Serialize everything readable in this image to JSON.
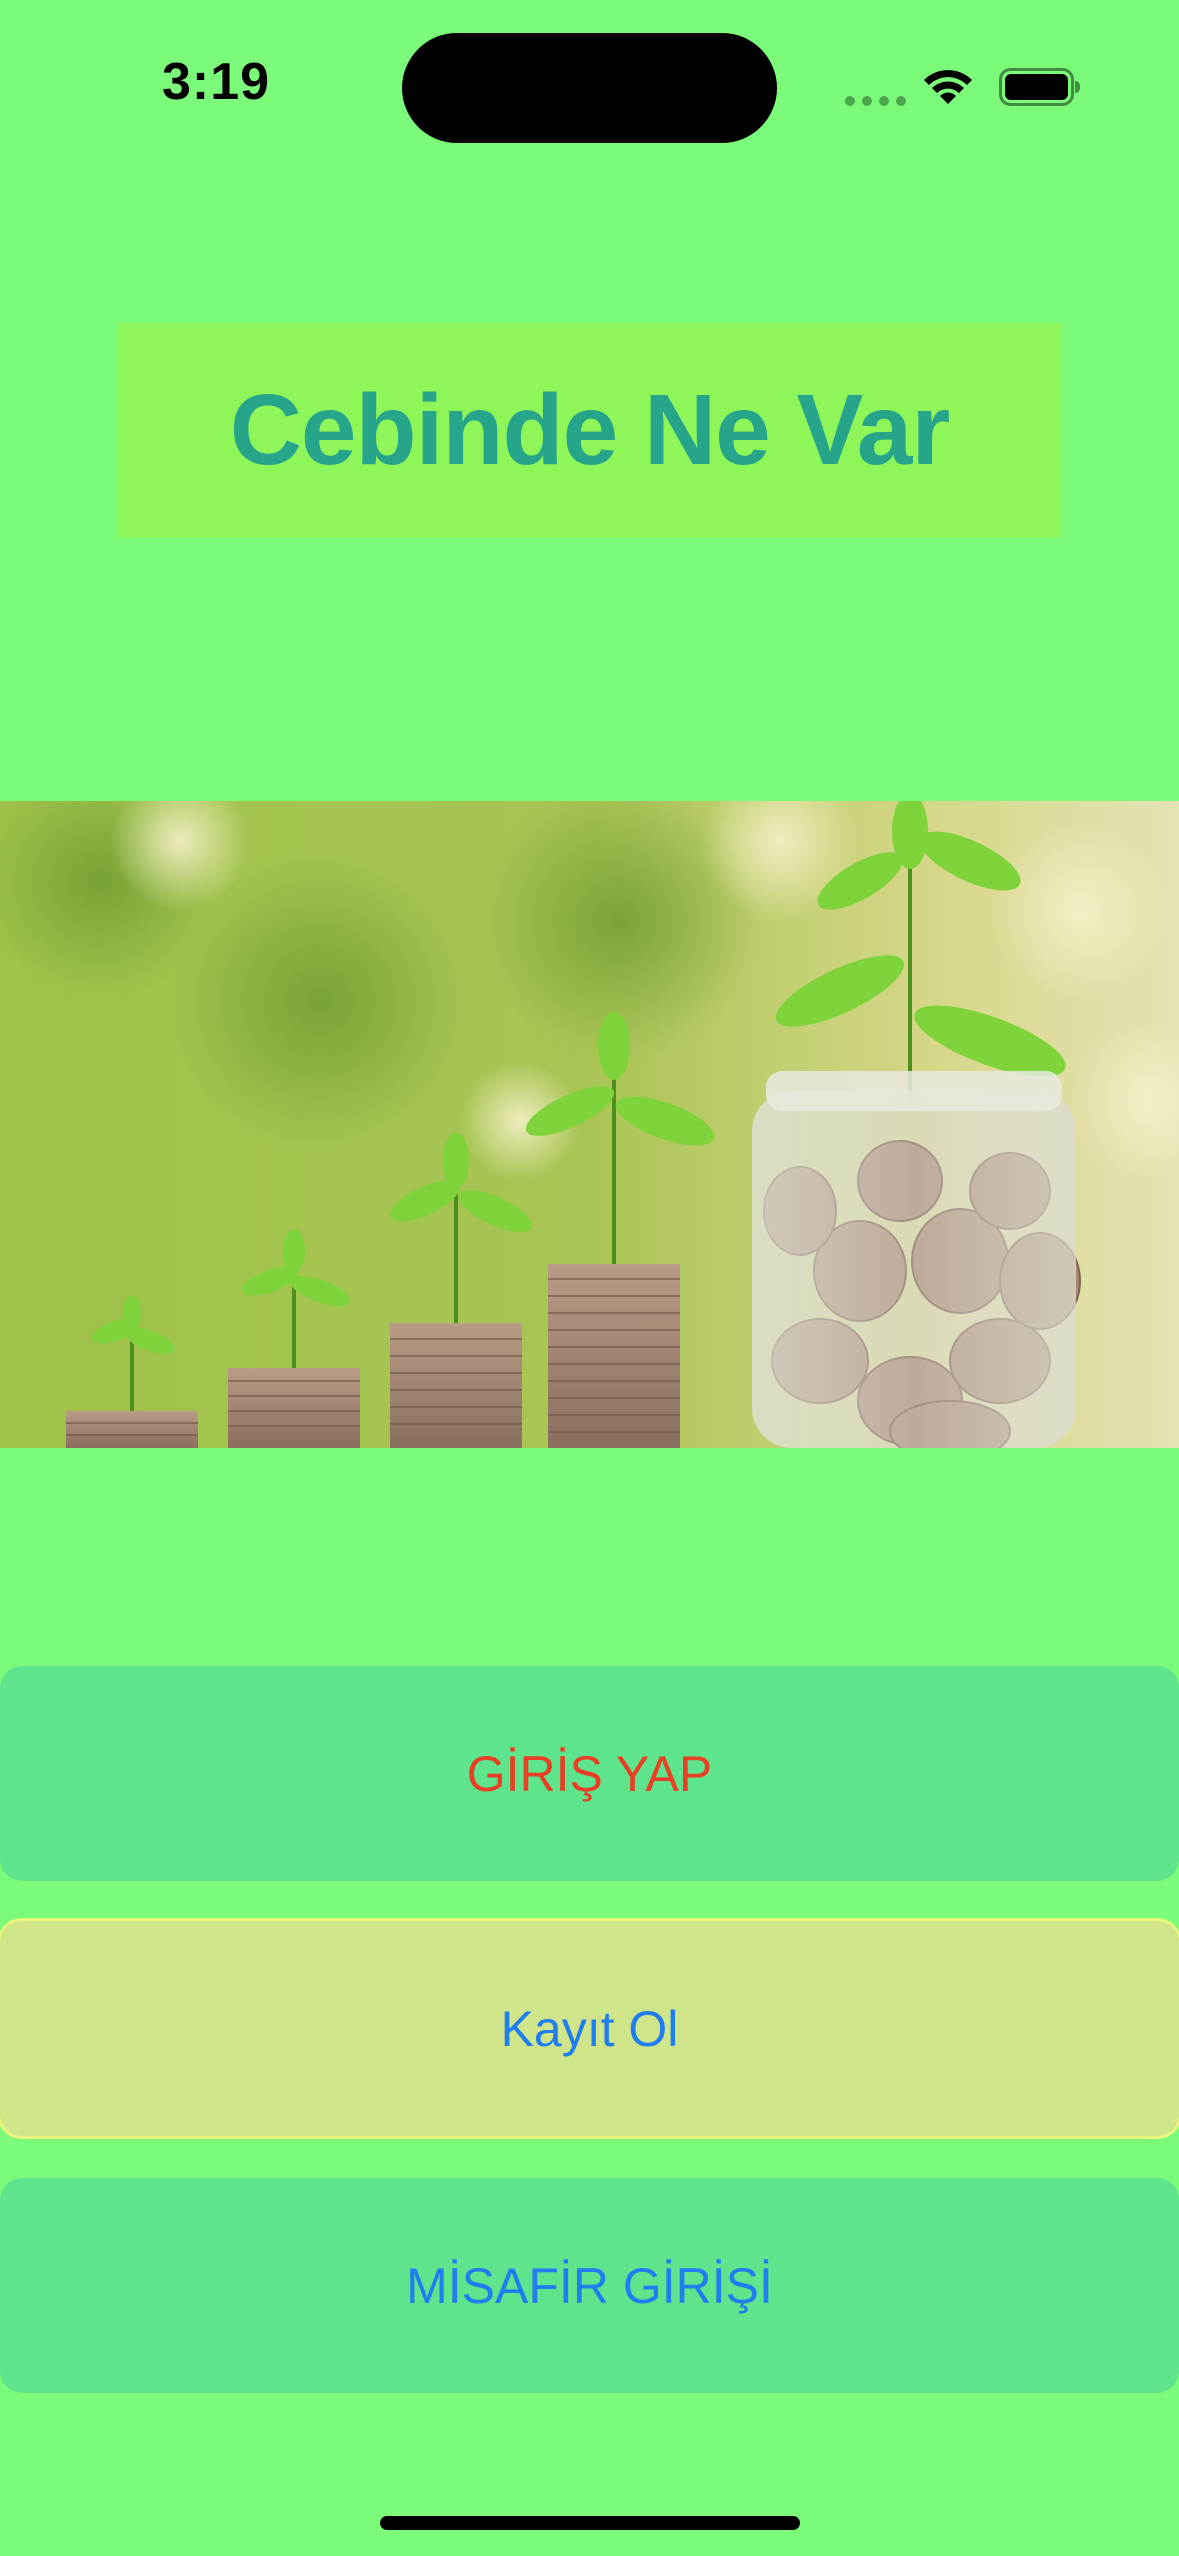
{
  "status_bar": {
    "time": "3:19"
  },
  "header": {
    "title": "Cebinde Ne Var"
  },
  "hero": {
    "icon": "savings-plants-coins-photo"
  },
  "actions": {
    "login_label": "GİRİŞ YAP",
    "register_label": "Kayıt Ol",
    "guest_label": "MİSAFİR GİRİŞİ"
  },
  "colors": {
    "background": "#7bfb79",
    "title_box": "#8ff65a",
    "title_text": "#27a58a",
    "button_green": "#5ee48c",
    "button_yellow": "#d0e48a",
    "login_text": "#ea3f24",
    "link_blue": "#1f7ff0"
  }
}
